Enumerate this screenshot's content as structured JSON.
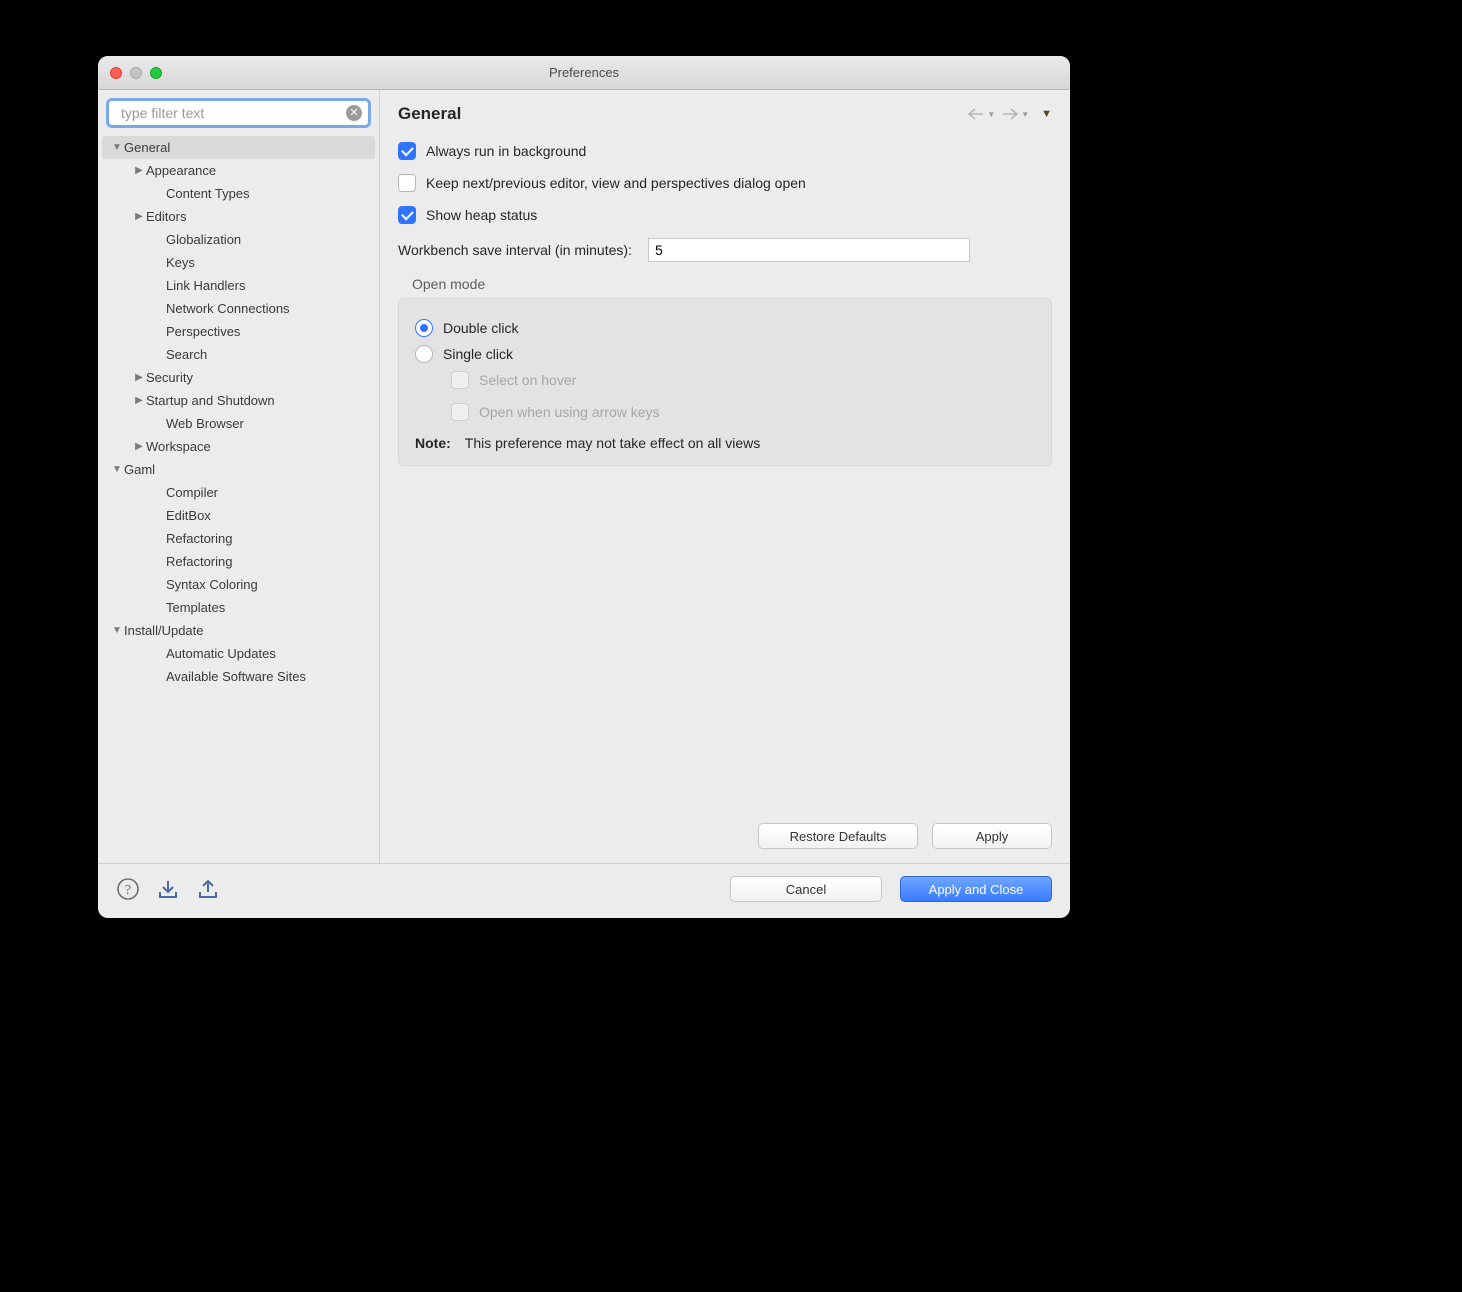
{
  "window": {
    "title": "Preferences"
  },
  "search": {
    "placeholder": "type filter text"
  },
  "tree": {
    "general": "General",
    "appearance": "Appearance",
    "content_types": "Content Types",
    "editors": "Editors",
    "globalization": "Globalization",
    "keys": "Keys",
    "link_handlers": "Link Handlers",
    "network_connections": "Network Connections",
    "perspectives": "Perspectives",
    "search": "Search",
    "security": "Security",
    "startup_shutdown": "Startup and Shutdown",
    "web_browser": "Web Browser",
    "workspace": "Workspace",
    "gaml": "Gaml",
    "compiler": "Compiler",
    "editbox": "EditBox",
    "refactoring1": "Refactoring",
    "refactoring2": "Refactoring",
    "syntax_coloring": "Syntax Coloring",
    "templates": "Templates",
    "install_update": "Install/Update",
    "automatic_updates": "Automatic Updates",
    "available_sites": "Available Software Sites"
  },
  "page": {
    "title": "General",
    "always_bg": "Always run in background",
    "keep_dialog": "Keep next/previous editor, view and perspectives dialog open",
    "show_heap": "Show heap status",
    "save_interval_label": "Workbench save interval (in minutes):",
    "save_interval_value": "5",
    "open_mode_legend": "Open mode",
    "double_click": "Double click",
    "single_click": "Single click",
    "select_hover": "Select on hover",
    "open_arrow": "Open when using arrow keys",
    "note_label": "Note:",
    "note_text": "This preference may not take effect on all views"
  },
  "buttons": {
    "restore": "Restore Defaults",
    "apply": "Apply",
    "cancel": "Cancel",
    "apply_close": "Apply and Close"
  }
}
